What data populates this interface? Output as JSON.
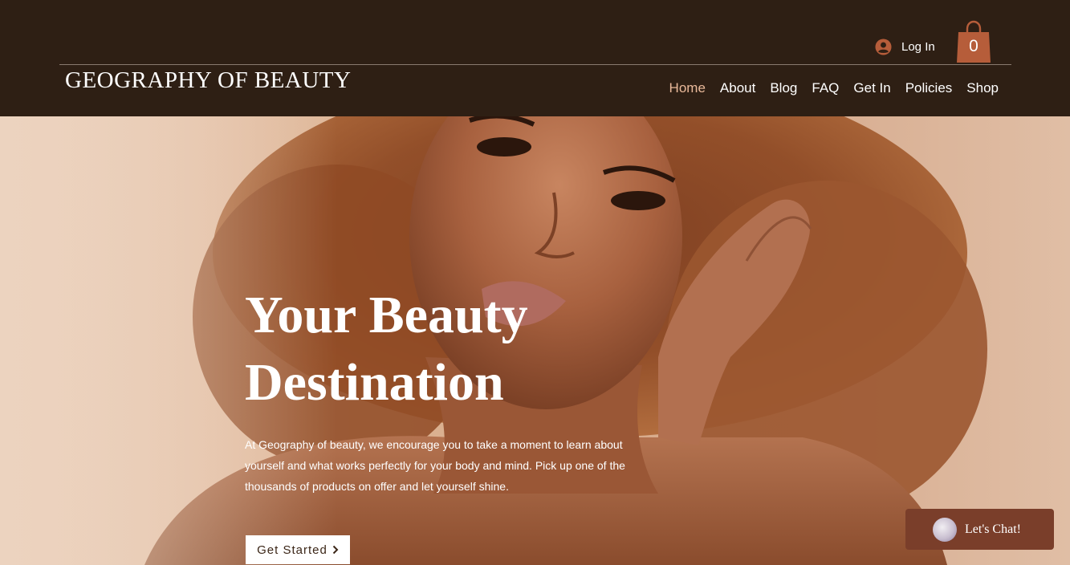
{
  "header": {
    "logo": "GEOGRAPHY OF BEAUTY",
    "login_label": "Log In",
    "cart_count": "0",
    "nav": [
      {
        "label": "Home",
        "active": true
      },
      {
        "label": "About",
        "active": false
      },
      {
        "label": "Blog",
        "active": false
      },
      {
        "label": "FAQ",
        "active": false
      },
      {
        "label": "Get In",
        "active": false
      },
      {
        "label": "Policies",
        "active": false
      },
      {
        "label": "Shop",
        "active": false
      }
    ]
  },
  "hero": {
    "title": "Your Beauty Destination",
    "body": "At Geography of beauty, we encourage you to take a moment to learn about yourself and what works perfectly for your body and mind. Pick up one of the thousands of products on offer and let yourself shine.",
    "cta_label": "Get Started",
    "cta_icon": "chevron-right-icon"
  },
  "chat": {
    "label": "Let's Chat!"
  },
  "colors": {
    "header_bg": "#2e1f14",
    "nav_active": "#e9b99a",
    "cart_accent": "#b65d3a",
    "chat_bg": "#7a3e2a"
  }
}
